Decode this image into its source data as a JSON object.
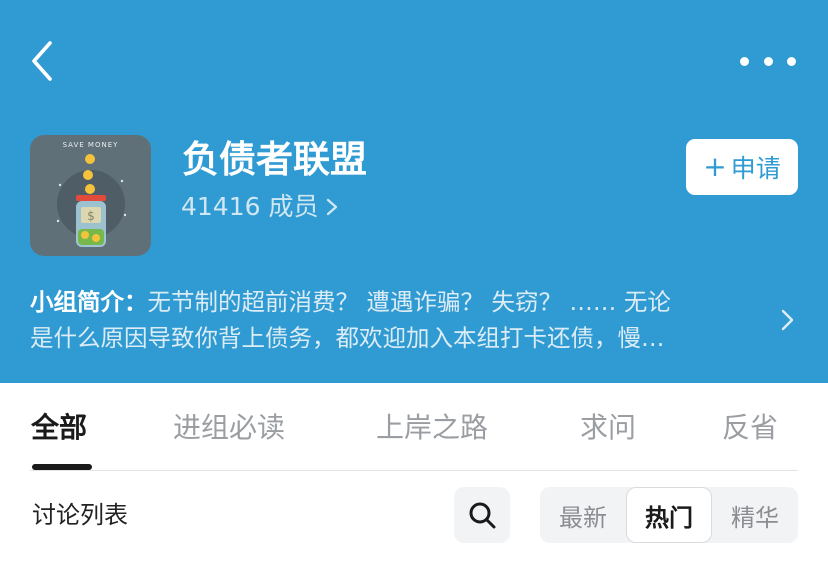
{
  "nav": {
    "back_icon": "chevron-left-icon",
    "more_icon": "more-dots-icon"
  },
  "group": {
    "avatar_text": "SAVE MONEY",
    "name": "负债者联盟",
    "members": "41416 成员",
    "join_label": "申请",
    "join_icon": "plus-icon",
    "intro_label": "小组简介：",
    "intro_line1": "无节制的超前消费？ 遭遇诈骗？ 失窃？ …… 无论",
    "intro_line2": "是什么原因导致你背上债务，都欢迎加入本组打卡还债，慢…"
  },
  "tabs": [
    {
      "label": "全部",
      "active": true
    },
    {
      "label": "进组必读",
      "active": false
    },
    {
      "label": "上岸之路",
      "active": false
    },
    {
      "label": "求问",
      "active": false
    },
    {
      "label": "反省",
      "active": false
    }
  ],
  "discussion": {
    "title": "讨论列表",
    "search_icon": "search-icon",
    "sort_options": [
      {
        "label": "最新",
        "active": false
      },
      {
        "label": "热门",
        "active": true
      },
      {
        "label": "精华",
        "active": false
      }
    ]
  },
  "colors": {
    "header_bg": "#2f9bd2",
    "accent": "#2f9bd2",
    "text_dark": "#1a1a1a",
    "text_muted": "#9a9ea2"
  }
}
